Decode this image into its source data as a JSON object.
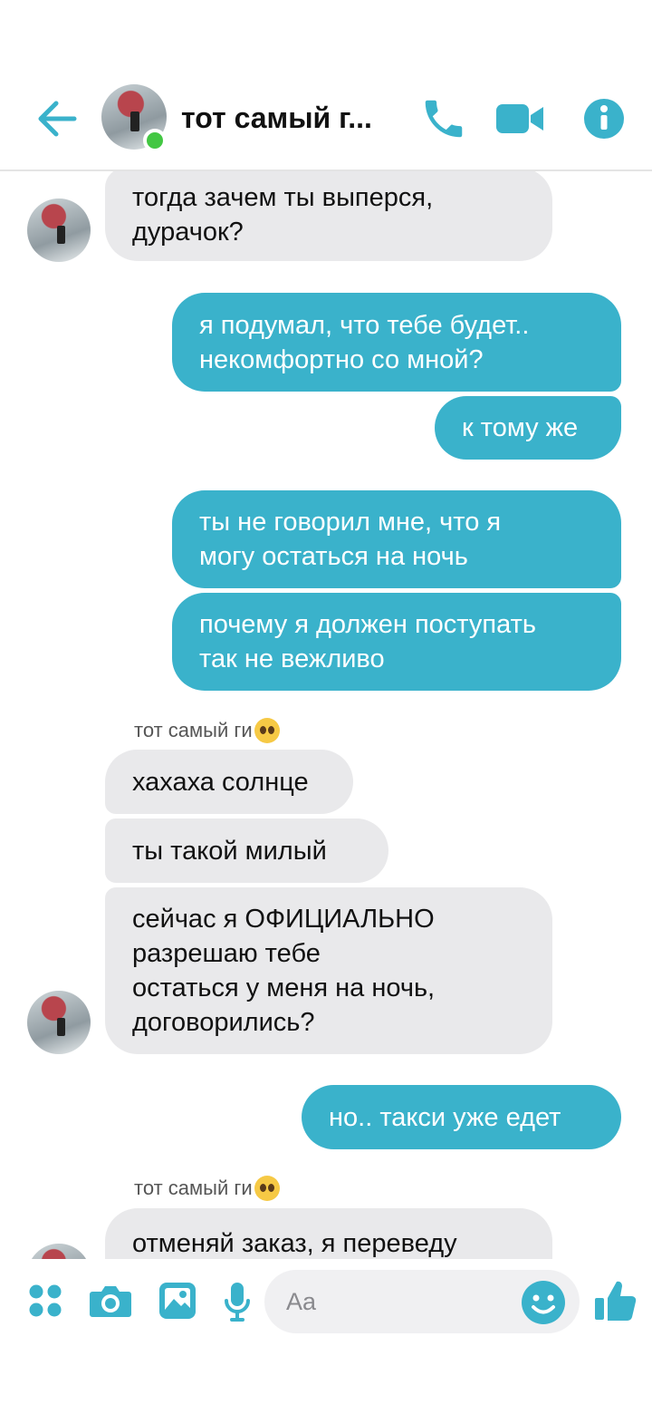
{
  "header": {
    "title": "тот самый г..."
  },
  "messages": {
    "m1": [
      "тогда зачем ты выперся,",
      "дурачок?"
    ],
    "m2": [
      "я подумал, что тебе будет..",
      "некомфортно со мной?"
    ],
    "m3": "к тому же",
    "m4": [
      "ты не говорил мне, что я",
      "могу остаться на ночь"
    ],
    "m5": [
      "почему я должен поступать",
      "так не вежливо"
    ],
    "sender1": "тот самый ги",
    "m6": "хахаха солнце",
    "m7": "ты такой милый",
    "m8": [
      "сейчас я ОФИЦИАЛЬНО",
      "разрешаю тебе",
      "остаться у меня на ночь,",
      "договорились?"
    ],
    "m9": "но.. такси уже едет",
    "sender2": "тот самый ги",
    "m10": "отменяй заказ, я переведу"
  },
  "composer": {
    "placeholder": "Aa"
  },
  "colors": {
    "accent": "#3ab2cb",
    "incoming_bubble": "#e9e9eb",
    "online": "#43c743"
  },
  "icons": [
    "back-arrow-icon",
    "phone-icon",
    "video-icon",
    "info-icon",
    "apps-icon",
    "camera-icon",
    "gallery-icon",
    "microphone-icon",
    "emoji-icon",
    "like-icon"
  ]
}
